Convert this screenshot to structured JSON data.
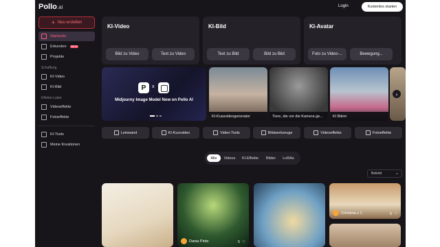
{
  "brand": {
    "name": "Pollo",
    "suffix": ".ai"
  },
  "header": {
    "login": "Login",
    "cta": "Kostenlos starten"
  },
  "sidebar": {
    "new_button": "Neu erstellen",
    "items": [
      {
        "label": "Startseite",
        "icon": "home-icon",
        "active": true
      },
      {
        "label": "Erkunden",
        "icon": "compass-icon",
        "badge": "BETA"
      },
      {
        "label": "Projekte",
        "icon": "folder-icon"
      }
    ],
    "section_create": "Schaffung",
    "create_items": [
      {
        "label": "KI-Video",
        "icon": "video-icon"
      },
      {
        "label": "KI-Bild",
        "icon": "image-icon"
      }
    ],
    "section_effects": "Effekte-Labor",
    "effect_items": [
      {
        "label": "Videoeffekte",
        "icon": "video-effects-icon"
      },
      {
        "label": "Fotoeffekte",
        "icon": "photo-effects-icon"
      }
    ],
    "bottom_items": [
      {
        "label": "KI-Tools",
        "icon": "tools-icon"
      },
      {
        "label": "Meine Kreationen",
        "icon": "user-icon"
      }
    ]
  },
  "feature_cards": [
    {
      "title": "KI-Video",
      "buttons": [
        "Bild zu Video",
        "Text zu Video"
      ]
    },
    {
      "title": "KI-Bild",
      "buttons": [
        "Text zu Bild",
        "Bild zu Bild"
      ]
    },
    {
      "title": "KI-Avatar",
      "buttons": [
        "Foto zu Video-...",
        "Bewegung..."
      ]
    }
  ],
  "banner": {
    "x_sign": "x",
    "caption": "Midjourny Image Model Now on Pollo AI"
  },
  "carousel": [
    {
      "label": "KI-Kussvideogenerator"
    },
    {
      "label": "Tiere, die vor die Kamera ge..."
    },
    {
      "label": "KI Bikini"
    }
  ],
  "tools": [
    {
      "label": "Leinwand",
      "icon": "canvas-icon"
    },
    {
      "label": "KI-Kurzvideo",
      "icon": "short-video-icon"
    },
    {
      "label": "Video-Tools",
      "icon": "video-tools-icon"
    },
    {
      "label": "Bildwerkzeuge",
      "icon": "image-tools-icon"
    },
    {
      "label": "Videoeffekte",
      "icon": "video-effects-icon"
    },
    {
      "label": "Fotoeffekte",
      "icon": "photo-effects-icon"
    }
  ],
  "filters": [
    "Alle",
    "Videos",
    "KI-Effekte",
    "Bilder",
    "LoRAs"
  ],
  "sort": {
    "value": "Beliebt"
  },
  "gallery": [
    {
      "author": "Dania Pinto",
      "likes": "5"
    },
    {
      "author": "Christina z 1",
      "likes": "5"
    }
  ]
}
